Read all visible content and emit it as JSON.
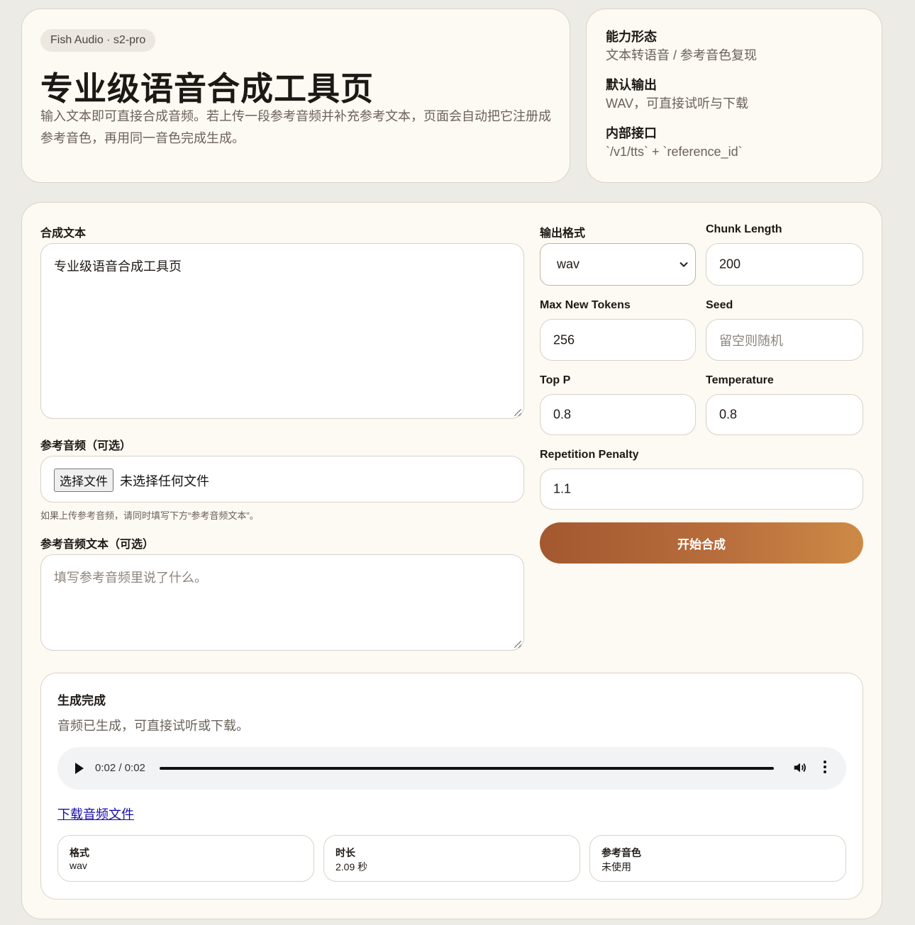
{
  "hero": {
    "badge": "Fish Audio · s2-pro",
    "title": "专业级语音合成工具页",
    "description": "输入文本即可直接合成音频。若上传一段参考音频并补充参考文本，页面会自动把它注册成参考音色，再用同一音色完成生成。"
  },
  "info": {
    "items": [
      {
        "label": "能力形态",
        "value": "文本转语音 / 参考音色复现"
      },
      {
        "label": "默认输出",
        "value": "WAV，可直接试听与下载"
      },
      {
        "label": "内部接口",
        "value": "`/v1/tts` + `reference_id`"
      }
    ]
  },
  "form": {
    "text_label": "合成文本",
    "text_value": "专业级语音合成工具页",
    "ref_audio_label": "参考音频（可选）",
    "file_button": "选择文件",
    "file_status": "未选择任何文件",
    "ref_audio_hint": "如果上传参考音频，请同时填写下方“参考音频文本”。",
    "ref_text_label": "参考音频文本（可选）",
    "ref_text_placeholder": "填写参考音频里说了什么。",
    "format_label": "输出格式",
    "format_value": "wav",
    "chunk_label": "Chunk Length",
    "chunk_value": "200",
    "max_tokens_label": "Max New Tokens",
    "max_tokens_value": "256",
    "seed_label": "Seed",
    "seed_placeholder": "留空则随机",
    "top_p_label": "Top P",
    "top_p_value": "0.8",
    "temperature_label": "Temperature",
    "temperature_value": "0.8",
    "repetition_label": "Repetition Penalty",
    "repetition_value": "1.1",
    "submit_label": "开始合成"
  },
  "result": {
    "title": "生成完成",
    "description": "音频已生成，可直接试听或下载。",
    "player_time": "0:02 / 0:02",
    "player_progress": 1.0,
    "download_label": "下载音频文件",
    "stats": [
      {
        "label": "格式",
        "value": "wav"
      },
      {
        "label": "时长",
        "value": "2.09 秒"
      },
      {
        "label": "参考音色",
        "value": "未使用"
      }
    ]
  },
  "colors": {
    "accent_start": "#a3582f",
    "accent_end": "#cd8a45",
    "card_bg": "#fdf9f3",
    "link": "#1a0dab"
  }
}
